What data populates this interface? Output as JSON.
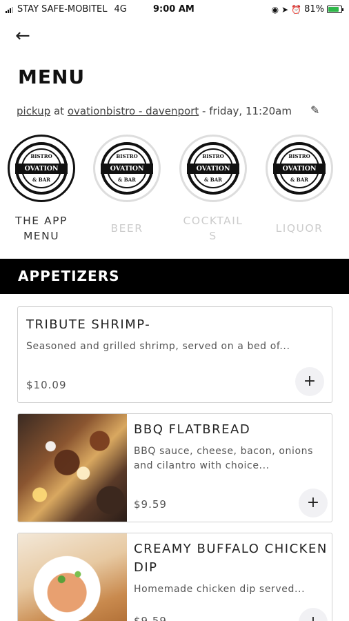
{
  "status_bar": {
    "carrier": "STAY SAFE-MOBITEL",
    "network": "4G",
    "time": "9:00 AM",
    "battery": "81%",
    "battery_level": 0.81,
    "icons": [
      "lock-rotation-icon",
      "location-arrow-icon",
      "alarm-icon",
      "battery-icon"
    ]
  },
  "header": {
    "back_icon": "arrow-left-icon",
    "title": "MENU",
    "order_type": "pickup",
    "at": "at",
    "location": "ovationbistro - davenport",
    "schedule": "- friday, 11:20am",
    "edit_icon": "pencil-icon"
  },
  "categories": [
    {
      "label": "THE APP MENU",
      "logo_top": "BISTRO",
      "logo_band": "OVATION",
      "logo_bottom": "& BAR",
      "active": true
    },
    {
      "label": "BEER",
      "logo_top": "BISTRO",
      "logo_band": "OVATION",
      "logo_bottom": "& BAR",
      "active": false
    },
    {
      "label": "COCKTAILS",
      "logo_top": "BISTRO",
      "logo_band": "OVATION",
      "logo_bottom": "& BAR",
      "active": false
    },
    {
      "label": "LIQUOR",
      "logo_top": "BISTRO",
      "logo_band": "OVATION",
      "logo_bottom": "& BAR",
      "active": false
    }
  ],
  "section": {
    "title": "APPETIZERS"
  },
  "items": [
    {
      "name": "TRIBUTE SHRIMP-",
      "description": "Seasoned and grilled shrimp, served on a bed of...",
      "price": "$10.09",
      "add": "+"
    },
    {
      "name": "BBQ FLATBREAD",
      "description": "BBQ sauce, cheese, bacon, onions and cilantro with choice...",
      "price": "$9.59",
      "add": "+"
    },
    {
      "name": "CREAMY BUFFALO CHICKEN DIP",
      "description": "Homemade chicken dip served...",
      "price": "$9.59",
      "add": "+"
    }
  ],
  "colors": {
    "section_bar": "#000000",
    "active_ring": "#111111",
    "inactive_ring": "#dddddd",
    "inactive_label": "#cccccc",
    "add_button_bg": "#f1f1f4"
  }
}
